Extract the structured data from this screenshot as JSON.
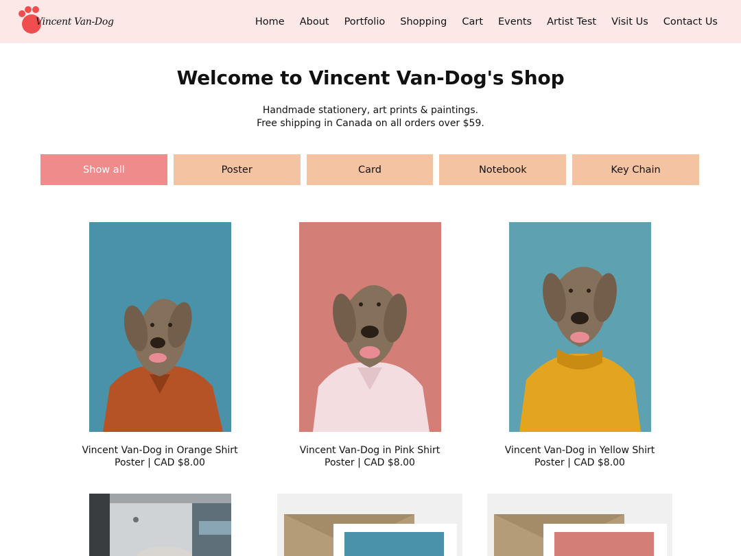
{
  "brand": {
    "name": "Vincent Van-Dog",
    "accent": "#f04e4e"
  },
  "nav": [
    "Home",
    "About",
    "Portfolio",
    "Shopping",
    "Cart",
    "Events",
    "Artist Test",
    "Visit Us",
    "Contact Us"
  ],
  "page": {
    "title": "Welcome to Vincent Van-Dog's Shop",
    "subtitle_line1": "Handmade stationery, art prints & paintings.",
    "subtitle_line2": "Free shipping in Canada on all orders over $59."
  },
  "filters": [
    "Show all",
    "Poster",
    "Card",
    "Notebook",
    "Key Chain"
  ],
  "active_filter": "Show all",
  "products": [
    {
      "name": "Vincent Van-Dog in Orange Shirt",
      "meta": "Poster | CAD $8.00",
      "background": "#4a92aa",
      "shirt": "#b55226"
    },
    {
      "name": "Vincent Van-Dog in Pink Shirt",
      "meta": "Poster | CAD $8.00",
      "background": "#d47e78",
      "shirt": "#f3dde0"
    },
    {
      "name": "Vincent Van-Dog in Yellow Shirt",
      "meta": "Poster | CAD $8.00",
      "background": "#5ea2b1",
      "shirt": "#e3a41f"
    }
  ],
  "colors": {
    "header_bg": "#fde8e8",
    "button_bg": "#f4c3a1",
    "button_active_bg": "#ee8c8c"
  }
}
